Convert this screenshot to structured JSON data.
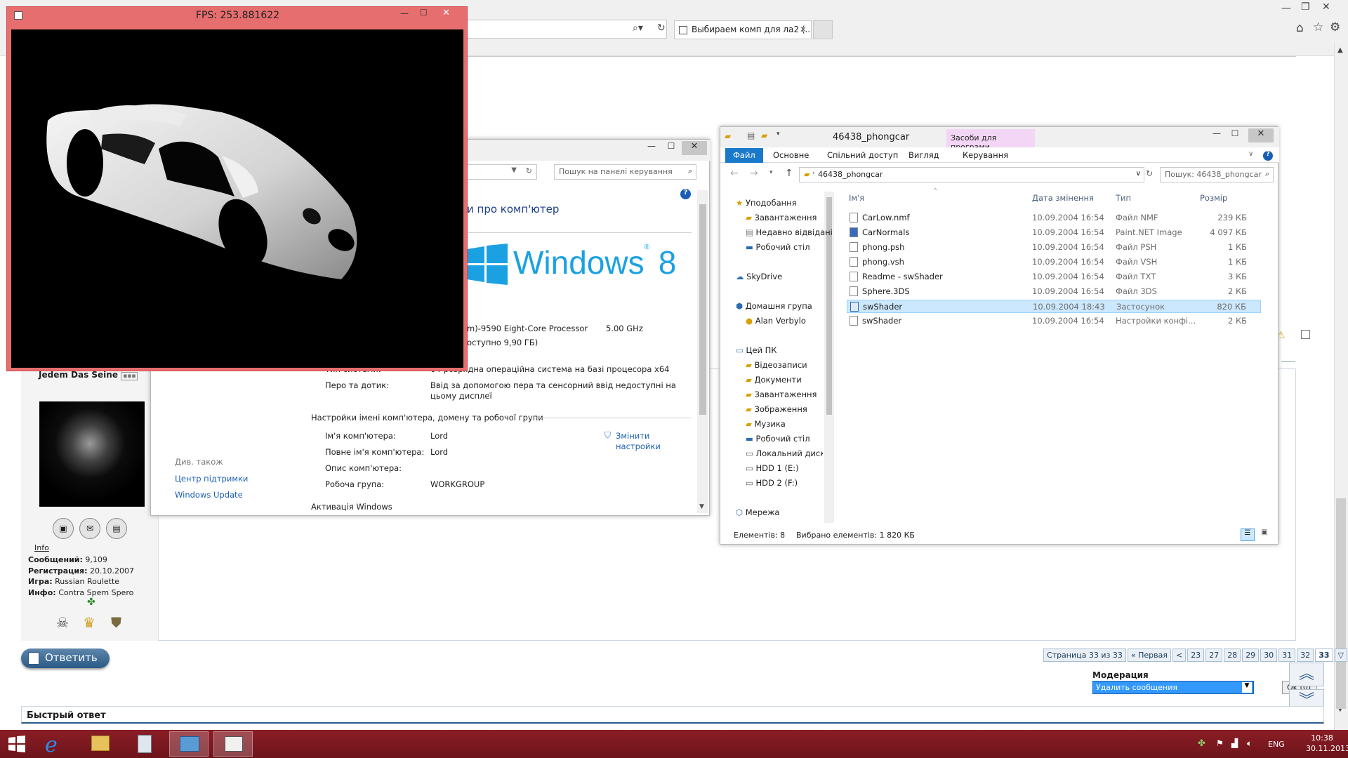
{
  "browser": {
    "tab_title": "Выбираем комп для ла2 (..."
  },
  "fps_window": {
    "title": "FPS: 253.881622"
  },
  "control_panel": {
    "search_placeholder": "Пошук на панелі керування",
    "heading": "и про комп'ютер",
    "windows_brand": "Windows",
    "windows_version": "8",
    "processor": "m)-9590 Eight-Core Processor",
    "processor_speed": "5.00 GHz",
    "ram_partial": "оступно 9,90 ГБ)",
    "system_type_label": "Тип системи:",
    "system_type": "64-розрядна операційна система на базі процесора x64",
    "pen_label": "Перо та дотик:",
    "pen_value": "Ввід за допомогою пера та сенсорний ввід недоступні на цьому дисплеї",
    "section_name": "Настройки імені комп'ютера, домену та робочої групи",
    "computer_name_label": "Ім'я комп'ютера:",
    "computer_name": "Lord",
    "full_name_label": "Повне ім'я комп'ютера:",
    "full_name": "Lord",
    "description_label": "Опис комп'ютера:",
    "workgroup_label": "Робоча група:",
    "workgroup": "WORKGROUP",
    "change_settings": "Змінити настройки",
    "activation": "Активація Windows",
    "see_also": "Див. також",
    "support_center": "Центр підтримки",
    "windows_update": "Windows Update"
  },
  "explorer": {
    "title": "46438_phongcar",
    "context_tab": "Засоби для програми",
    "context_sub": "Керування",
    "tabs": [
      "Файл",
      "Основне",
      "Спільний доступ",
      "Вигляд"
    ],
    "address": "46438_phongcar",
    "search_placeholder": "Пошук: 46438_phongcar",
    "columns": [
      "Ім'я",
      "Дата змінення",
      "Тип",
      "Розмір"
    ],
    "nav": [
      "Уподобання",
      "Завантаження",
      "Недавно відвідані",
      "Робочий стіл",
      "SkyDrive",
      "Домашня група",
      "Alan Verbylo",
      "Цей ПК",
      "Відеозаписи",
      "Документи",
      "Завантаження",
      "Зображення",
      "Музика",
      "Робочий стіл",
      "Локальний диск",
      "HDD 1 (E:)",
      "HDD 2 (F:)",
      "Мережа"
    ],
    "files": [
      {
        "name": "CarLow.nmf",
        "date": "10.09.2004 16:54",
        "type": "Файл NMF",
        "size": "239 КБ"
      },
      {
        "name": "CarNormals",
        "date": "10.09.2004 16:54",
        "type": "Paint.NET Image",
        "size": "4 097 КБ"
      },
      {
        "name": "phong.psh",
        "date": "10.09.2004 16:54",
        "type": "Файл PSH",
        "size": "1 КБ"
      },
      {
        "name": "phong.vsh",
        "date": "10.09.2004 16:54",
        "type": "Файл VSH",
        "size": "1 КБ"
      },
      {
        "name": "Readme - swShader",
        "date": "10.09.2004 16:54",
        "type": "Файл TXT",
        "size": "3 КБ"
      },
      {
        "name": "Sphere.3DS",
        "date": "10.09.2004 16:54",
        "type": "Файл 3DS",
        "size": "2 КБ"
      },
      {
        "name": "swShader",
        "date": "10.09.2004 18:43",
        "type": "Застосунок",
        "size": "820 КБ"
      },
      {
        "name": "swShader",
        "date": "10.09.2004 16:54",
        "type": "Настройки конфі...",
        "size": "2 КБ"
      }
    ],
    "status_count": "Елементів: 8",
    "status_selected": "Вибрано елементів: 1  820 КБ"
  },
  "forum": {
    "username": "Jedem Das Seine",
    "info_link": "Info",
    "stats": [
      {
        "label": "Сообщений:",
        "value": "9,109"
      },
      {
        "label": "Регистрация:",
        "value": "20.10.2007"
      },
      {
        "label": "Игра:",
        "value": "Russian Roulette"
      },
      {
        "label": "Инфо:",
        "value": "Contra Spem Spero"
      }
    ],
    "reply_button": "Ответить",
    "pager": [
      "Страница 33 из 33",
      "« Первая",
      "<",
      "23",
      "27",
      "28",
      "29",
      "30",
      "31",
      "32",
      "33"
    ],
    "moderation_label": "Модерация",
    "moderation_select": "Удалить сообщения",
    "ok_button": "Ok (0)",
    "quick_reply": "Быстрый ответ"
  },
  "taskbar": {
    "language": "ENG",
    "time": "10:38",
    "date": "30.11.2013"
  },
  "colors": {
    "taskbar": "#7a1820",
    "fps_frame": "#e66e6e",
    "accent": "#1979ca"
  }
}
